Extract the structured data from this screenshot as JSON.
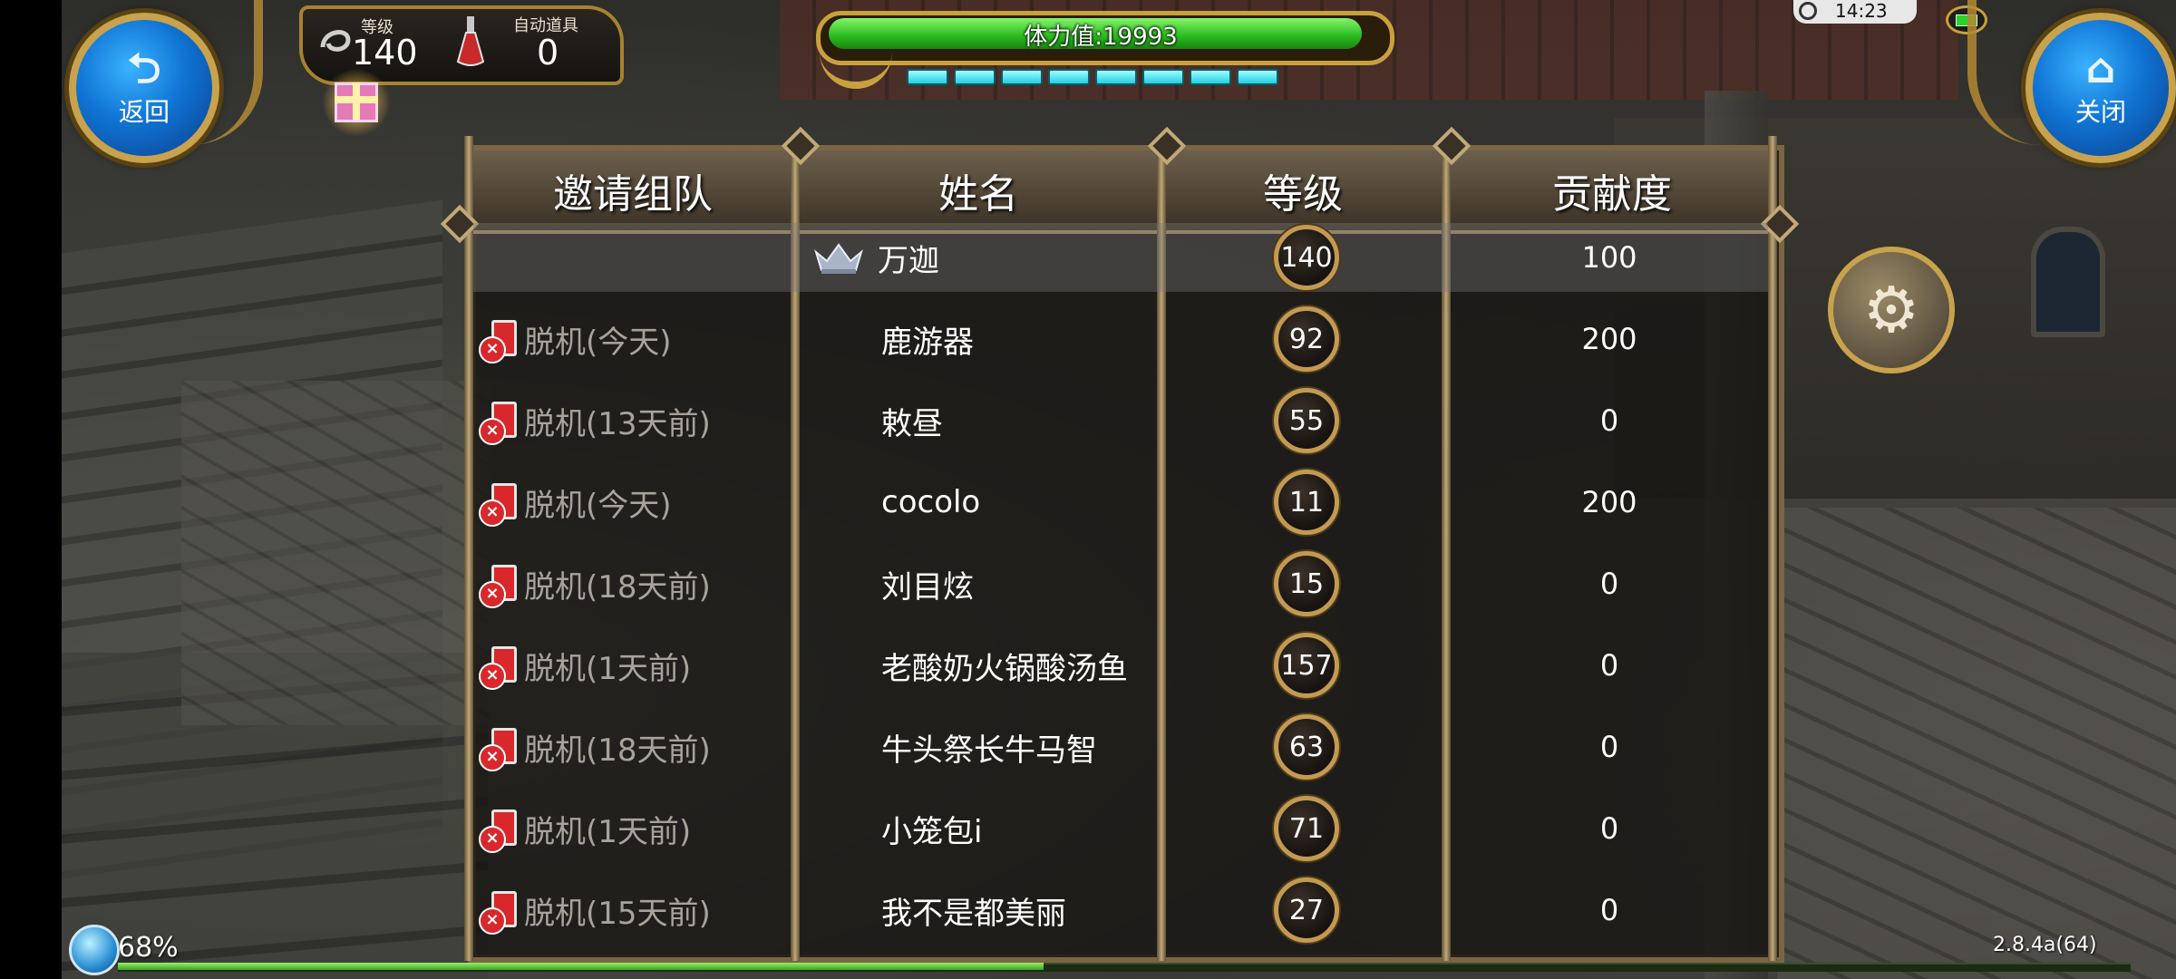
{
  "hud": {
    "back_label": "返回",
    "close_label": "关闭",
    "level_label": "等级",
    "level_value": "140",
    "auto_item_label": "自动道具",
    "auto_item_value": "0",
    "stamina_text": "体力值:19993",
    "stamina_fraction": 0.98,
    "energy_segments": 8,
    "clock": "14:23",
    "network_percent": "68%",
    "xp_fraction": 0.46,
    "version": "2.8.4a(64)"
  },
  "table": {
    "headers": [
      "邀请组队",
      "姓名",
      "等级",
      "贡献度"
    ],
    "rows": [
      {
        "status": "",
        "name": "万迦",
        "level": "140",
        "contribution": "100",
        "leader": true
      },
      {
        "status": "脱机(今天)",
        "name": "鹿游器",
        "level": "92",
        "contribution": "200"
      },
      {
        "status": "脱机(13天前)",
        "name": "敕昼",
        "level": "55",
        "contribution": "0"
      },
      {
        "status": "脱机(今天)",
        "name": "cocolo",
        "level": "11",
        "contribution": "200"
      },
      {
        "status": "脱机(18天前)",
        "name": "刘目炫",
        "level": "15",
        "contribution": "0"
      },
      {
        "status": "脱机(1天前)",
        "name": "老酸奶火锅酸汤鱼",
        "level": "157",
        "contribution": "0"
      },
      {
        "status": "脱机(18天前)",
        "name": "牛头祭长牛马智",
        "level": "63",
        "contribution": "0"
      },
      {
        "status": "脱机(1天前)",
        "name": "小笼包i",
        "level": "71",
        "contribution": "0"
      },
      {
        "status": "脱机(15天前)",
        "name": "我不是都美丽",
        "level": "27",
        "contribution": "0"
      }
    ]
  },
  "colors": {
    "stamina_green": "#2fbf21",
    "energy_cyan": "#1fd0e0",
    "offline_red": "#d8282c",
    "frame_gold": "#c9a13c"
  },
  "icons": {
    "back": "back-arrow-icon",
    "close": "home-icon",
    "gift": "gift-icon",
    "potion": "potion-icon",
    "leader": "crown-icon",
    "offline": "offline-phone-icon",
    "settings": "gear-icon"
  }
}
